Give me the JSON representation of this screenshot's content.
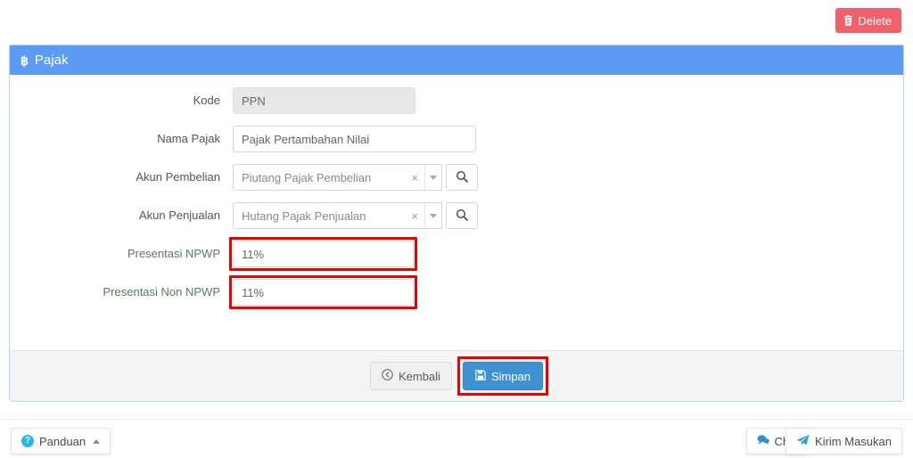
{
  "topbar": {
    "delete_label": "Delete",
    "delete_color": "#f0616b"
  },
  "panel": {
    "title": "Pajak",
    "icon": "bitcoin-icon",
    "icon_glyph": "฿",
    "header_color": "#5b9bf5",
    "border_color": "#b9d5f2"
  },
  "form": {
    "fields": [
      {
        "label": "Kode",
        "value": "PPN",
        "type": "text",
        "disabled": true
      },
      {
        "label": "Nama Pajak",
        "value": "Pajak Pertambahan Nilai",
        "type": "text",
        "disabled": false
      },
      {
        "label": "Akun Pembelian",
        "value": "Piutang Pajak Pembelian",
        "type": "select-search",
        "clear_glyph": "×",
        "search_icon": "search-icon"
      },
      {
        "label": "Akun Penjualan",
        "value": "Hutang Pajak Penjualan",
        "type": "select-search",
        "clear_glyph": "×",
        "search_icon": "search-icon"
      },
      {
        "label": "Presentasi NPWP",
        "value": "11%",
        "type": "text",
        "highlighted": true,
        "label_color": "#5a7a5f"
      },
      {
        "label": "Presentasi Non NPWP",
        "value": "11%",
        "type": "text",
        "highlighted": true,
        "label_color": "#5a7a5f"
      }
    ]
  },
  "panel_footer": {
    "back_label": "Kembali",
    "save_label": "Simpan",
    "save_color": "#3f92d2",
    "save_highlighted": true
  },
  "page_footer": {
    "panduan_label": "Panduan",
    "chat_label": "Chat",
    "kirim_label": "Kirim Masukan",
    "accent_color": "#29b6e8"
  },
  "annotation": {
    "color": "#ee0000"
  }
}
